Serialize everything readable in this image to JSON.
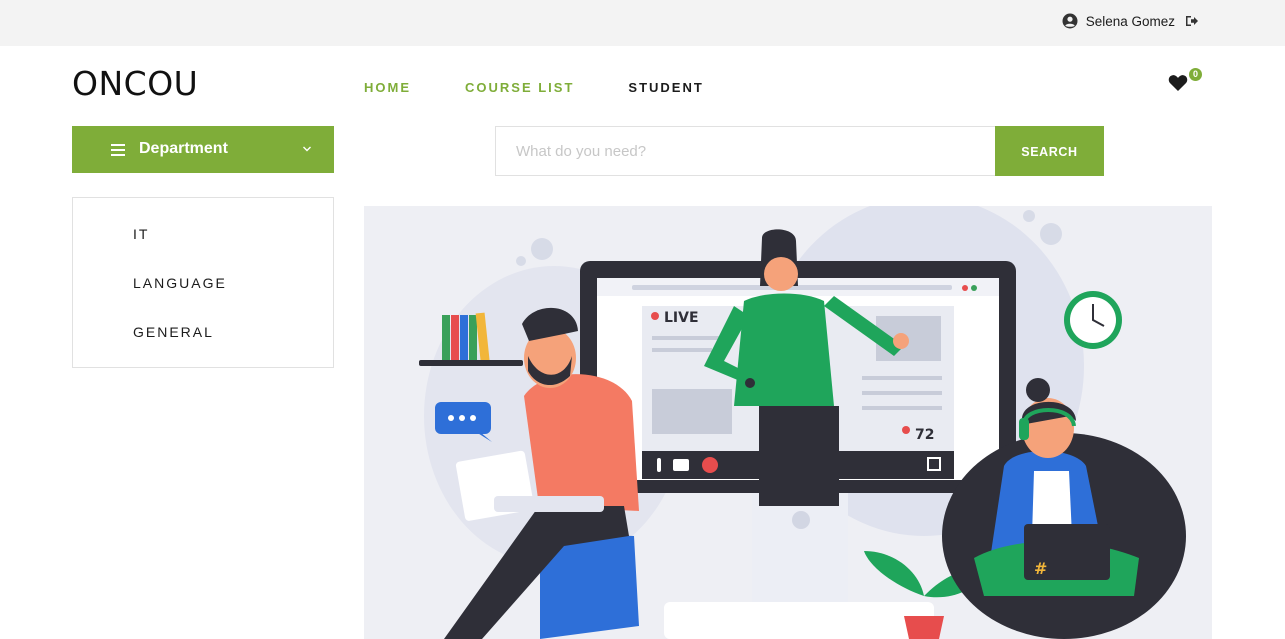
{
  "topbar": {
    "username": "Selena Gomez",
    "user_icon": "user-circle-icon",
    "logout_icon": "sign-out-icon"
  },
  "header": {
    "logo": "ONCOU",
    "nav": [
      {
        "label": "HOME",
        "active": false
      },
      {
        "label": "COURSE LIST",
        "active": false
      },
      {
        "label": "STUDENT",
        "active": true
      }
    ],
    "wishlist_count": "0",
    "wishlist_icon": "heart-icon"
  },
  "sidebar": {
    "department_label": "Department",
    "items": [
      {
        "label": "IT"
      },
      {
        "label": "LANGUAGE"
      },
      {
        "label": "GENERAL"
      }
    ]
  },
  "search": {
    "placeholder": "What do you need?",
    "button_label": "SEARCH"
  },
  "hero": {
    "live_label": "LIVE",
    "viewer_count": "72"
  },
  "colors": {
    "accent": "#7fad39",
    "topbar_bg": "#f3f3f3",
    "hero_bg": "#eeeff4"
  }
}
